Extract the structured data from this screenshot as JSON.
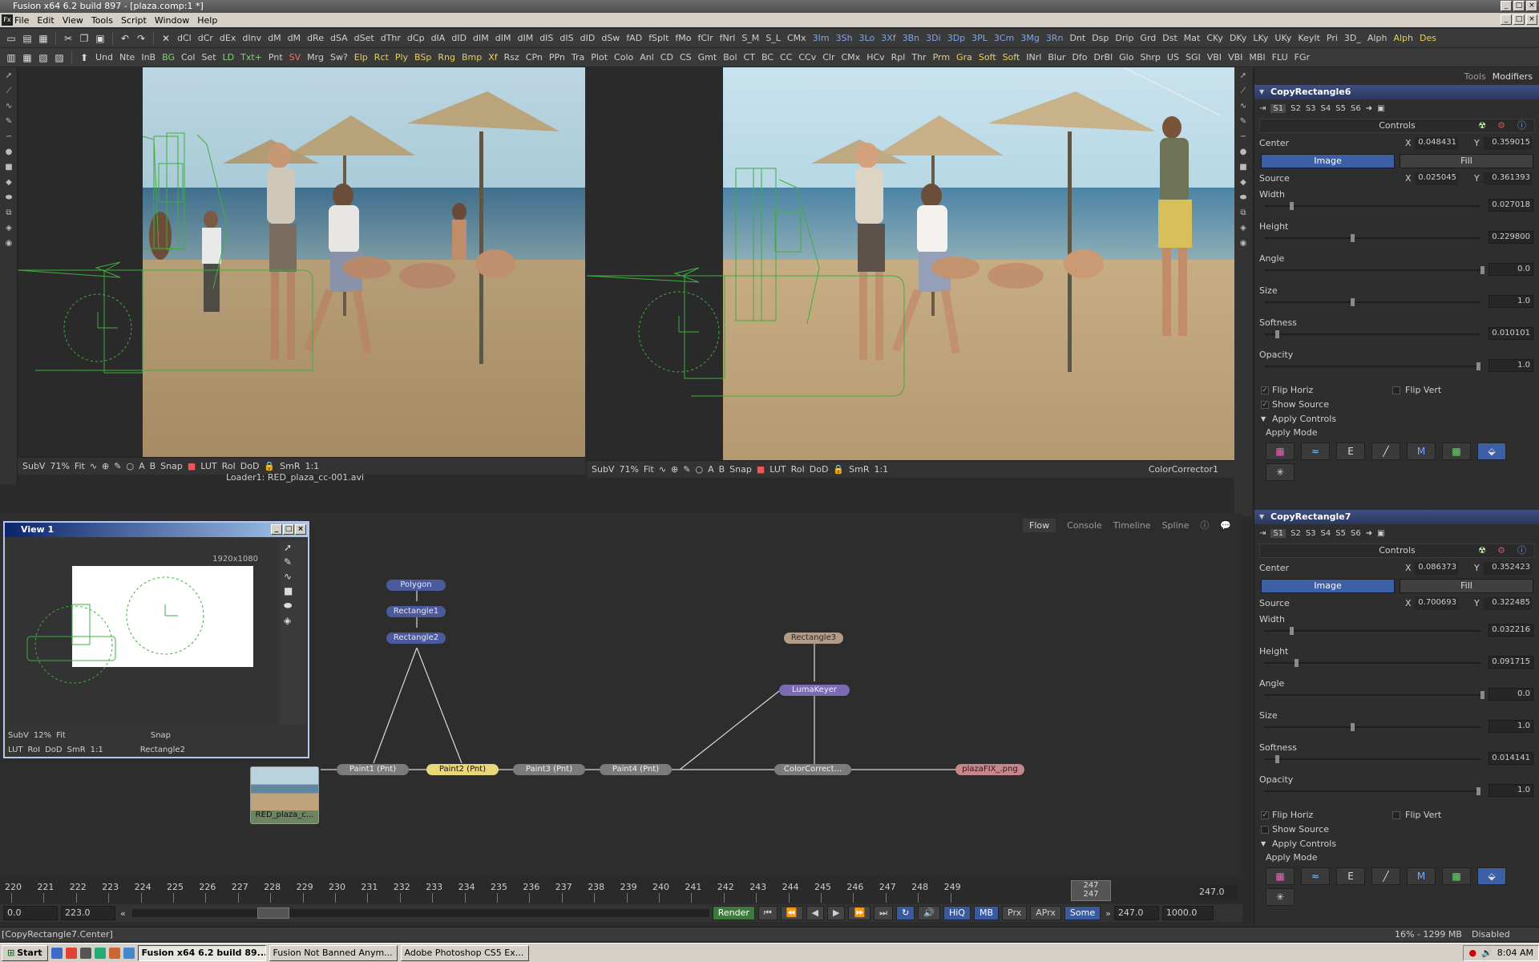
{
  "window": {
    "title": "Fusion x64 6.2 build 897 - [plaza.comp:1 *]"
  },
  "menu": [
    "File",
    "Edit",
    "View",
    "Tools",
    "Script",
    "Window",
    "Help"
  ],
  "toolbar1": [
    "dCl",
    "dCr",
    "dEx",
    "dInv",
    "dM",
    "dM",
    "dRe",
    "dSA",
    "dSet",
    "dThr",
    "dCp",
    "dIA",
    "dID",
    "dIM",
    "dIM",
    "dIM",
    "dIS",
    "dIS",
    "dID",
    "dSw",
    "fAD",
    "fSplt",
    "fMo",
    "fClr",
    "fNrl",
    "S_M",
    "S_L",
    "CMx",
    "3Im",
    "3Sh",
    "3Lo",
    "3Xf",
    "3Bn",
    "3Di",
    "3Dp",
    "3PL",
    "3Cm",
    "3Mg",
    "3Rn",
    "Dnt",
    "Dsp",
    "Drip",
    "Grd",
    "Dst",
    "Mat",
    "CKy",
    "DKy",
    "LKy",
    "UKy",
    "KeyIt",
    "Pri",
    "3D_",
    "Alph",
    "Alph",
    "Des"
  ],
  "toolbar2": [
    "Und",
    "Nte",
    "InB",
    "BG",
    "Col",
    "Set",
    "LD",
    "Txt+",
    "Pnt",
    "SV",
    "Mrg",
    "Sw?",
    "Elp",
    "Rct",
    "Ply",
    "BSp",
    "Rng",
    "Bmp",
    "Xf",
    "Rsz",
    "CPn",
    "PPn",
    "Tra",
    "Plot",
    "Colo",
    "Anl",
    "CD",
    "CS",
    "Gmt",
    "Bol",
    "CT",
    "BC",
    "CC",
    "CCv",
    "Clr",
    "CMx",
    "HCv",
    "Rpl",
    "Thr",
    "Prm",
    "Gra",
    "Soft",
    "Soft",
    "INrl",
    "Blur",
    "Dfo",
    "DrBl",
    "Glo",
    "Shrp",
    "US",
    "SGI",
    "VBI",
    "VBI",
    "MBI",
    "FLU",
    "FGr"
  ],
  "viewer_left": {
    "subv": "SubV",
    "zoom": "71%",
    "fit": "Fit",
    "snap": "Snap",
    "lut": "LUT",
    "roi": "RoI",
    "dod": "DoD",
    "smr": "SmR",
    "one": "1:1",
    "status": "Loader1: RED_plaza_cc-001.avi"
  },
  "viewer_right": {
    "subv": "SubV",
    "zoom": "71%",
    "fit": "Fit",
    "snap": "Snap",
    "lut": "LUT",
    "roi": "RoI",
    "dod": "DoD",
    "smr": "SmR",
    "one": "1:1",
    "status": "ColorCorrector1"
  },
  "mini_view": {
    "title": "View 1",
    "res": "1920x1080",
    "subv": "SubV",
    "zoom": "12%",
    "fit": "Fit",
    "snap": "Snap",
    "lut": "LUT",
    "roi": "RoI",
    "dod": "DoD",
    "smr": "SmR",
    "one": "1:1",
    "tool": "Rectangle2"
  },
  "flow_tabs": [
    "Flow",
    "Console",
    "Timeline",
    "Spline"
  ],
  "nodes": {
    "polygon": "Polygon",
    "rect1": "Rectangle1",
    "rect2": "Rectangle2",
    "rect3": "Rectangle3",
    "lumakeyer": "LumaKeyer",
    "paint1": "Paint1 (Pnt)",
    "paint2": "Paint2 (Pnt)",
    "paint3": "Paint3 (Pnt)",
    "paint4": "Paint4 (Pnt)",
    "colorcorrect": "ColorCorrect...",
    "saver": "plazaFIX_.png",
    "loader": "RED_plaza_c..."
  },
  "ruler_ticks": [
    "220",
    "221",
    "222",
    "223",
    "224",
    "225",
    "226",
    "227",
    "228",
    "229",
    "230",
    "231",
    "232",
    "233",
    "234",
    "235",
    "236",
    "237",
    "238",
    "239",
    "240",
    "241",
    "242",
    "243",
    "244",
    "245",
    "246",
    "247",
    "248",
    "249"
  ],
  "current_frame_box": "247",
  "current_frame_box2": "247",
  "ruler_end": "247.0",
  "transport": {
    "start": "0.0",
    "render_start": "223.0",
    "render": "Render",
    "hiq": "HiQ",
    "mb": "MB",
    "prx": "Prx",
    "aprx": "APrx",
    "some": "Some",
    "render_end": "247.0",
    "end": "1000.0"
  },
  "status": {
    "text": "[CopyRectangle7.Center]",
    "mem": "16% - 1299 MB",
    "disabled": "Disabled"
  },
  "right_tabs": {
    "tools": "Tools",
    "modifiers": "Modifiers"
  },
  "sections": [
    {
      "name": "CopyRectangle6",
      "tabs": [
        "S1",
        "S2",
        "S3",
        "S4",
        "S5",
        "S6"
      ],
      "controls": "Controls",
      "center_label": "Center",
      "center_x": "0.048431",
      "center_y": "0.359015",
      "image": "Image",
      "fill": "Fill",
      "source_label": "Source",
      "source_x": "0.025045",
      "source_y": "0.361393",
      "params": [
        {
          "label": "Width",
          "value": "0.027018"
        },
        {
          "label": "Height",
          "value": "0.229800"
        },
        {
          "label": "Angle",
          "value": "0.0"
        },
        {
          "label": "Size",
          "value": "1.0"
        },
        {
          "label": "Softness",
          "value": "0.010101"
        },
        {
          "label": "Opacity",
          "value": "1.0"
        }
      ],
      "flip_horiz": "Flip Horiz",
      "flip_vert": "Flip Vert",
      "show_source": "Show Source",
      "apply_controls": "Apply Controls",
      "apply_mode": "Apply Mode"
    },
    {
      "name": "CopyRectangle7",
      "tabs": [
        "S1",
        "S2",
        "S3",
        "S4",
        "S5",
        "S6"
      ],
      "controls": "Controls",
      "center_label": "Center",
      "center_x": "0.086373",
      "center_y": "0.352423",
      "image": "Image",
      "fill": "Fill",
      "source_label": "Source",
      "source_x": "0.700693",
      "source_y": "0.322485",
      "params": [
        {
          "label": "Width",
          "value": "0.032216"
        },
        {
          "label": "Height",
          "value": "0.091715"
        },
        {
          "label": "Angle",
          "value": "0.0"
        },
        {
          "label": "Size",
          "value": "1.0"
        },
        {
          "label": "Softness",
          "value": "0.014141"
        },
        {
          "label": "Opacity",
          "value": "1.0"
        }
      ],
      "flip_horiz": "Flip Horiz",
      "flip_vert": "Flip Vert",
      "show_source": "Show Source",
      "apply_controls": "Apply Controls",
      "apply_mode": "Apply Mode"
    }
  ],
  "taskbar": {
    "start": "Start",
    "items": [
      "Fusion x64 6.2 build 89...",
      "Fusion Not Banned Anym...",
      "Adobe Photoshop CS5 Ex..."
    ],
    "clock": "8:04 AM"
  }
}
